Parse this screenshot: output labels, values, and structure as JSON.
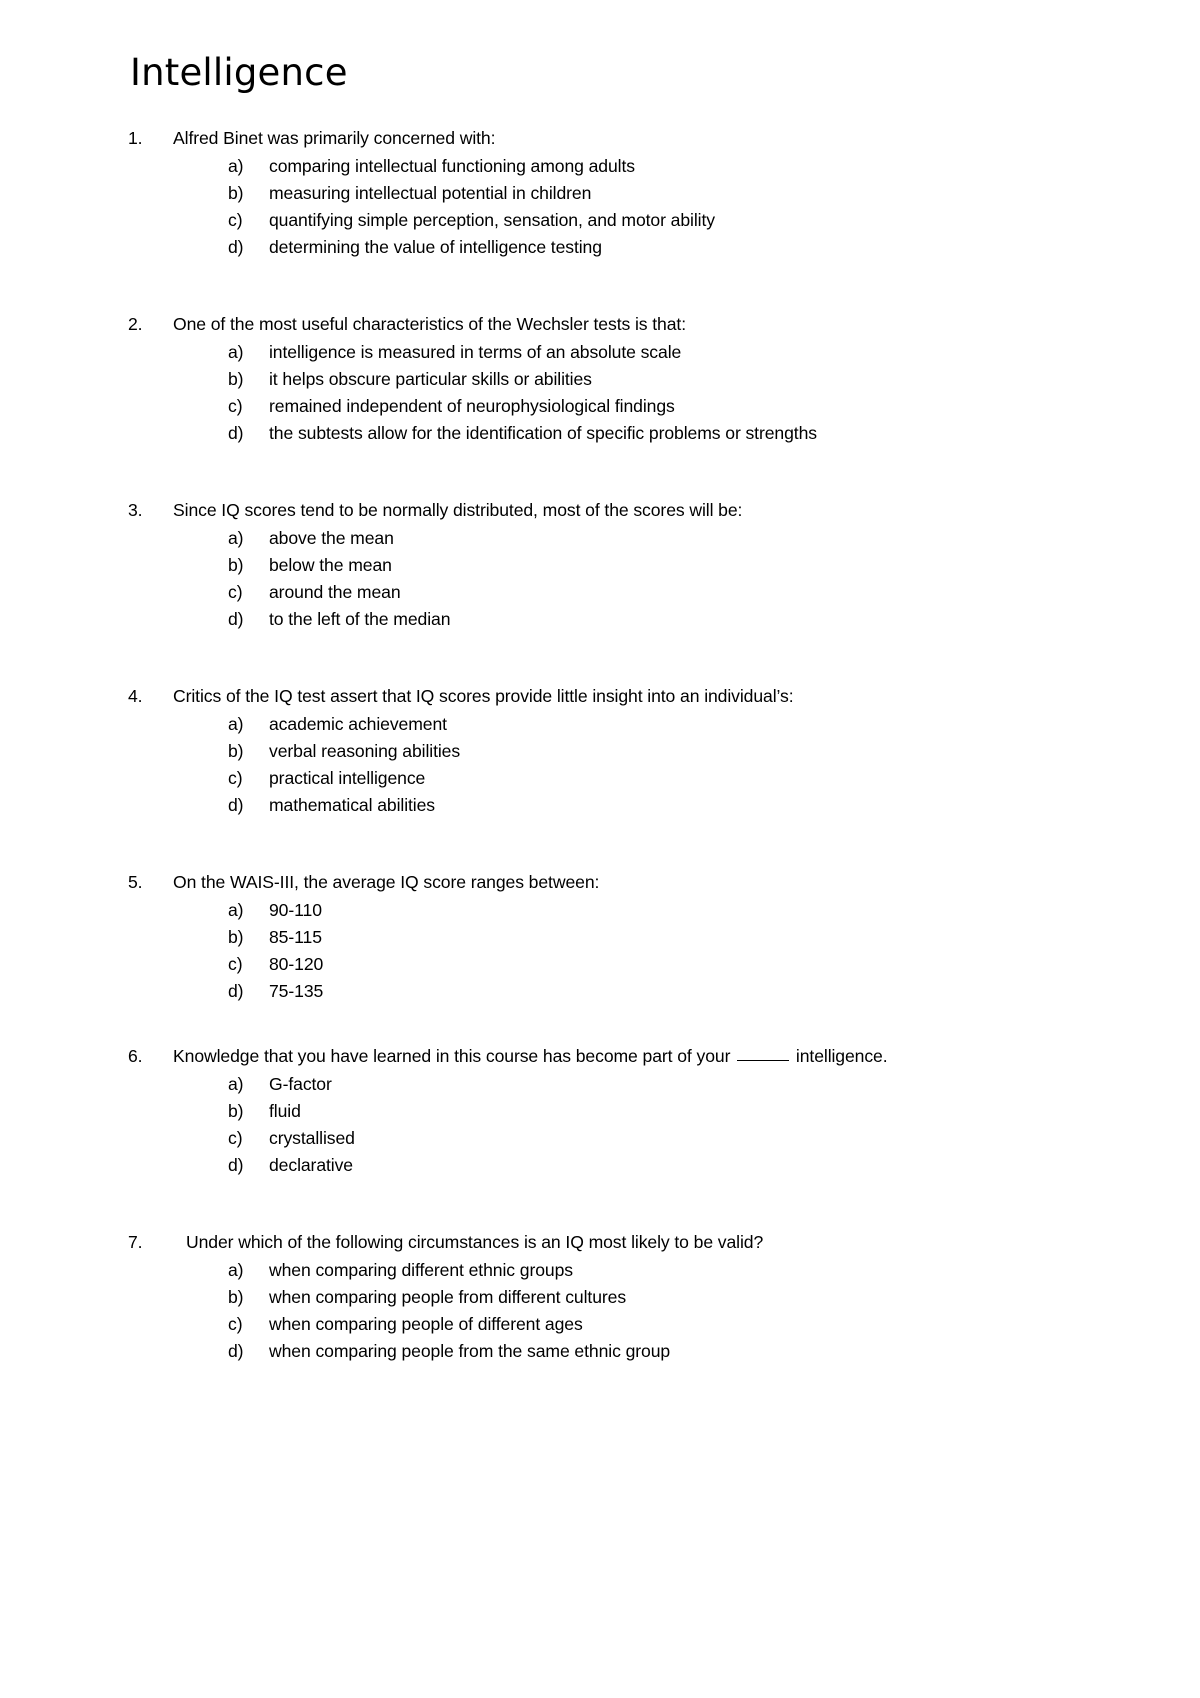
{
  "document": {
    "title": "Intelligence",
    "questions": [
      {
        "number": "1.",
        "text": "Alfred Binet was primarily concerned with:",
        "options": [
          {
            "marker": "a)",
            "text": "comparing intellectual functioning among adults"
          },
          {
            "marker": "b)",
            "text": "measuring intellectual potential in children"
          },
          {
            "marker": "c)",
            "text": "quantifying simple perception, sensation, and motor ability"
          },
          {
            "marker": "d)",
            "text": "determining the value of intelligence testing"
          }
        ]
      },
      {
        "number": "2.",
        "text": "One of the most useful characteristics of the Wechsler tests is that:",
        "options": [
          {
            "marker": "a)",
            "text": "intelligence is measured in terms of an absolute scale"
          },
          {
            "marker": "b)",
            "text": "it helps obscure particular skills or abilities"
          },
          {
            "marker": "c)",
            "text": "remained independent of neurophysiological findings"
          },
          {
            "marker": "d)",
            "text": "the subtests allow for the identification of specific problems or strengths"
          }
        ]
      },
      {
        "number": "3.",
        "text": "Since IQ scores tend to be normally distributed, most of the scores will be:",
        "options": [
          {
            "marker": "a)",
            "text": "above the mean"
          },
          {
            "marker": "b)",
            "text": "below the mean"
          },
          {
            "marker": "c)",
            "text": "around the mean"
          },
          {
            "marker": "d)",
            "text": "to the left of the median"
          }
        ]
      },
      {
        "number": "4.",
        "text": "Critics of the IQ test assert that IQ scores provide little insight into an individual’s:",
        "options": [
          {
            "marker": "a)",
            "text": "academic achievement"
          },
          {
            "marker": "b)",
            "text": "verbal reasoning abilities"
          },
          {
            "marker": "c)",
            "text": "practical intelligence"
          },
          {
            "marker": "d)",
            "text": "mathematical abilities"
          }
        ]
      },
      {
        "number": "5.",
        "text": "On the WAIS-III, the average IQ score ranges between:",
        "options": [
          {
            "marker": "a)",
            "text": "90-110"
          },
          {
            "marker": "b)",
            "text": "85-115"
          },
          {
            "marker": "c)",
            "text": "80-120"
          },
          {
            "marker": "d)",
            "text": "75-135"
          }
        ]
      },
      {
        "number": "6.",
        "text_before_blank": "Knowledge that you have learned in this course has become part of your ",
        "text_after_blank": " intelligence.",
        "options": [
          {
            "marker": "a)",
            "text": "G-factor"
          },
          {
            "marker": "b)",
            "text": "fluid"
          },
          {
            "marker": "c)",
            "text": "crystallised"
          },
          {
            "marker": "d)",
            "text": "declarative"
          }
        ]
      },
      {
        "number": "7.",
        "text": "Under which of the following circumstances is an IQ most likely to be valid?",
        "options": [
          {
            "marker": "a)",
            "text": "when comparing different ethnic groups"
          },
          {
            "marker": "b)",
            "text": "when comparing people from different cultures"
          },
          {
            "marker": "c)",
            "text": "when comparing people of different ages"
          },
          {
            "marker": "d)",
            "text": "when comparing people from the same ethnic group"
          }
        ]
      }
    ]
  }
}
